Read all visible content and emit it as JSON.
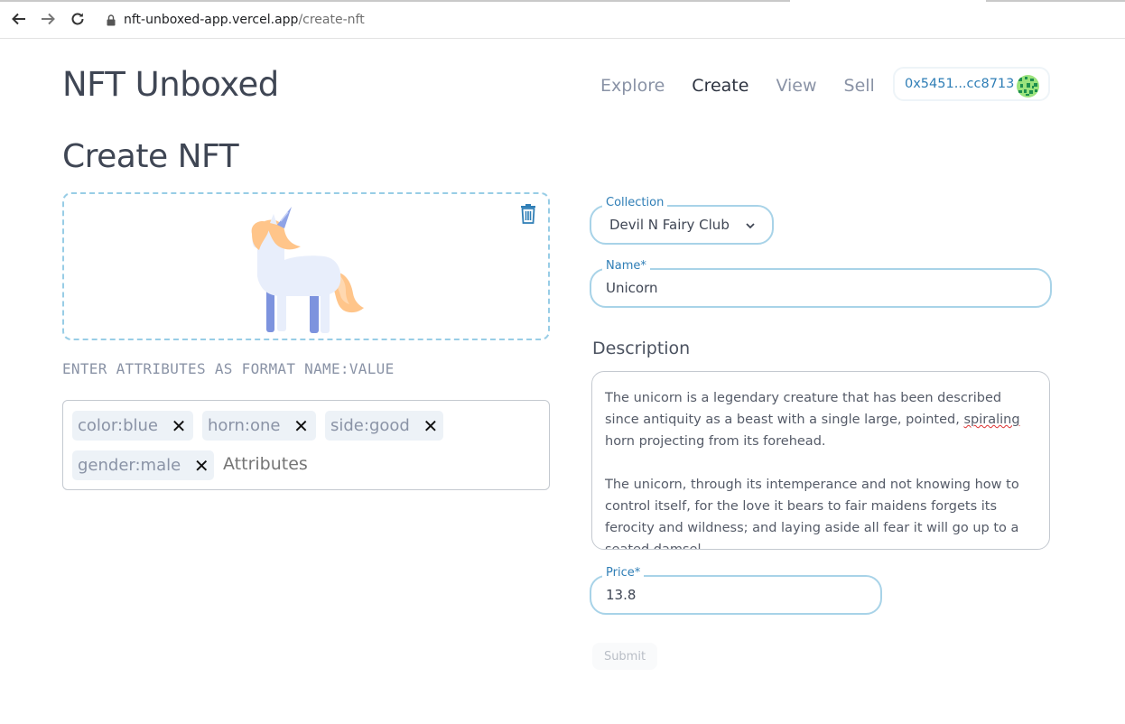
{
  "browser": {
    "url_host": "nft-unboxed-app.vercel.app",
    "url_path": "/create-nft"
  },
  "header": {
    "brand": "NFT Unboxed",
    "nav": [
      {
        "label": "Explore",
        "active": false
      },
      {
        "label": "Create",
        "active": true
      },
      {
        "label": "View",
        "active": false
      },
      {
        "label": "Sell",
        "active": false
      }
    ],
    "wallet": "0x5451...cc8713"
  },
  "page": {
    "title": "Create NFT"
  },
  "attributes": {
    "hint": "ENTER ATTRIBUTES AS FORMAT NAME:VALUE",
    "tags": [
      "color:blue",
      "horn:one",
      "side:good",
      "gender:male"
    ],
    "placeholder": "Attributes"
  },
  "form": {
    "collection": {
      "label": "Collection",
      "value": "Devil N Fairy Club"
    },
    "name": {
      "label": "Name*",
      "value": "Unicorn"
    },
    "description": {
      "label": "Description",
      "para1_before": "The unicorn is a legendary creature that has been described since antiquity as a beast with a single large, pointed, ",
      "para1_spell": "spiraling",
      "para1_after": " horn projecting from its forehead.",
      "para2": "The unicorn, through its intemperance and not knowing how to control itself, for the love it bears to fair maidens forgets its ferocity and wildness; and laying aside all fear it will go up to a seated damsel"
    },
    "price": {
      "label": "Price*",
      "value": "13.8"
    },
    "submit": "Submit"
  },
  "colors": {
    "accent": "#2f7eb6",
    "field_border": "#a8d3e8",
    "dropzone_border": "#98cde6"
  }
}
